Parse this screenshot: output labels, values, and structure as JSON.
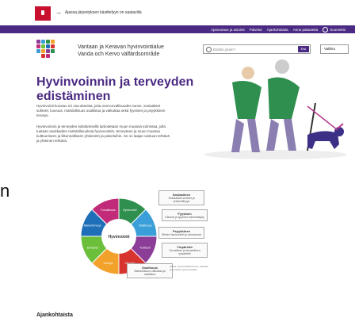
{
  "alert": {
    "text": "Ajassa järjestyksen käsittelyyn on saatavilla"
  },
  "topnav": {
    "items": [
      "Ajanvaraus ja asiointi",
      "Palvelut",
      "Ajankohtaista",
      "Anna palautetta"
    ],
    "language": "Suomeksi"
  },
  "header": {
    "org_line1": "Vantaan ja Keravan hyvinvointialue",
    "org_line2": "Vanda och Kervo välfärdsområde",
    "search_placeholder": "Etsitkö jotain?",
    "search_button": "Etsi",
    "menu_label": "Valikko"
  },
  "hero": {
    "title": "Hyvinvoinnin ja terveyden edistäminen",
    "paragraph1": "Hyvinvointi koostuu eri osa-alueista, joita ovat turvallisuuden tunne, sosiaaliset suhteet, luovuus, mahdollisuus osallistua ja vaikuttaa sekä fyysinen ja psyykkinen terveys.",
    "paragraph2": "Hyvinvoinnin ja terveyden edistämisellä tarkoitetaan muun muassa toimintaa, jolla tuetaan asukkaiden mahdollisuuksia hyvinvointiin, terveyteen ja muun muassa kulttuuriseen ja liikunnalliseen yhteisöön ja palveluihin. Se on laajan vastuun tehtävä ja yhteinen tehtävä."
  },
  "left_glyph": "n",
  "wheel": {
    "center": "Hyvinvointi",
    "segments": [
      "Hyvinvointi",
      "Osallisuus",
      "Kulttuuri",
      "Liikunta",
      "Terveys",
      "Elintavat",
      "Mielenterveys",
      "Turvallisuus"
    ],
    "colors": [
      "#2f8f4e",
      "#3a9fd8",
      "#8b3d98",
      "#d8342f",
      "#f2a12a",
      "#6bbf3a",
      "#1e6fb8",
      "#c22b7a"
    ]
  },
  "callouts": [
    {
      "title": "Sosiaalinen",
      "desc": "Sosiaaliset suhteet ja yhteisöllisyys"
    },
    {
      "title": "Fyysinen",
      "desc": "Liikunta ja fyysinen toimintakyky"
    },
    {
      "title": "Psyykkinen",
      "desc": "Mielen hyvinvointi ja voimavarat"
    },
    {
      "title": "Ympäristö",
      "desc": "Turvallinen ja terveellinen ympäristö"
    },
    {
      "title": "Osallisuus",
      "desc": "Mahdollisuus vaikuttaa ja osallistua"
    }
  ],
  "source_text": "Lähde: hyvinvointikertomus, Vantaan ja Keravan hyvinvointialue",
  "news": {
    "title": "Ajankohtaista"
  }
}
